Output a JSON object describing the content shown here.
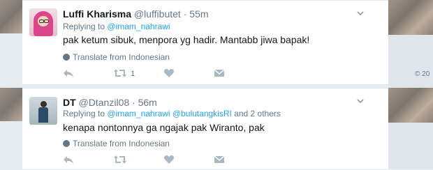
{
  "copyright": "© 20",
  "tweets": [
    {
      "name": "Luffi Kharisma",
      "handle": "@luffibutet",
      "dot": "·",
      "time": "55m",
      "replying_prefix": "Replying to",
      "replying_to": "@imam_nahrawi",
      "replying_suffix": "",
      "text": "pak ketum sibuk, menpora yg hadir. Mantabb jiwa bapak!",
      "translate": "Translate from Indonesian",
      "retweet_count": "1"
    },
    {
      "name": "DT",
      "handle": "@Dtanzil08",
      "dot": "·",
      "time": "56m",
      "replying_prefix": "Replying to",
      "replying_to": "@imam_nahrawi @bulutangkisRI",
      "replying_suffix": "and 2 others",
      "text": "kenapa nontonnya ga ngajak pak Wiranto, pak",
      "translate": "Translate from Indonesian",
      "retweet_count": ""
    }
  ]
}
